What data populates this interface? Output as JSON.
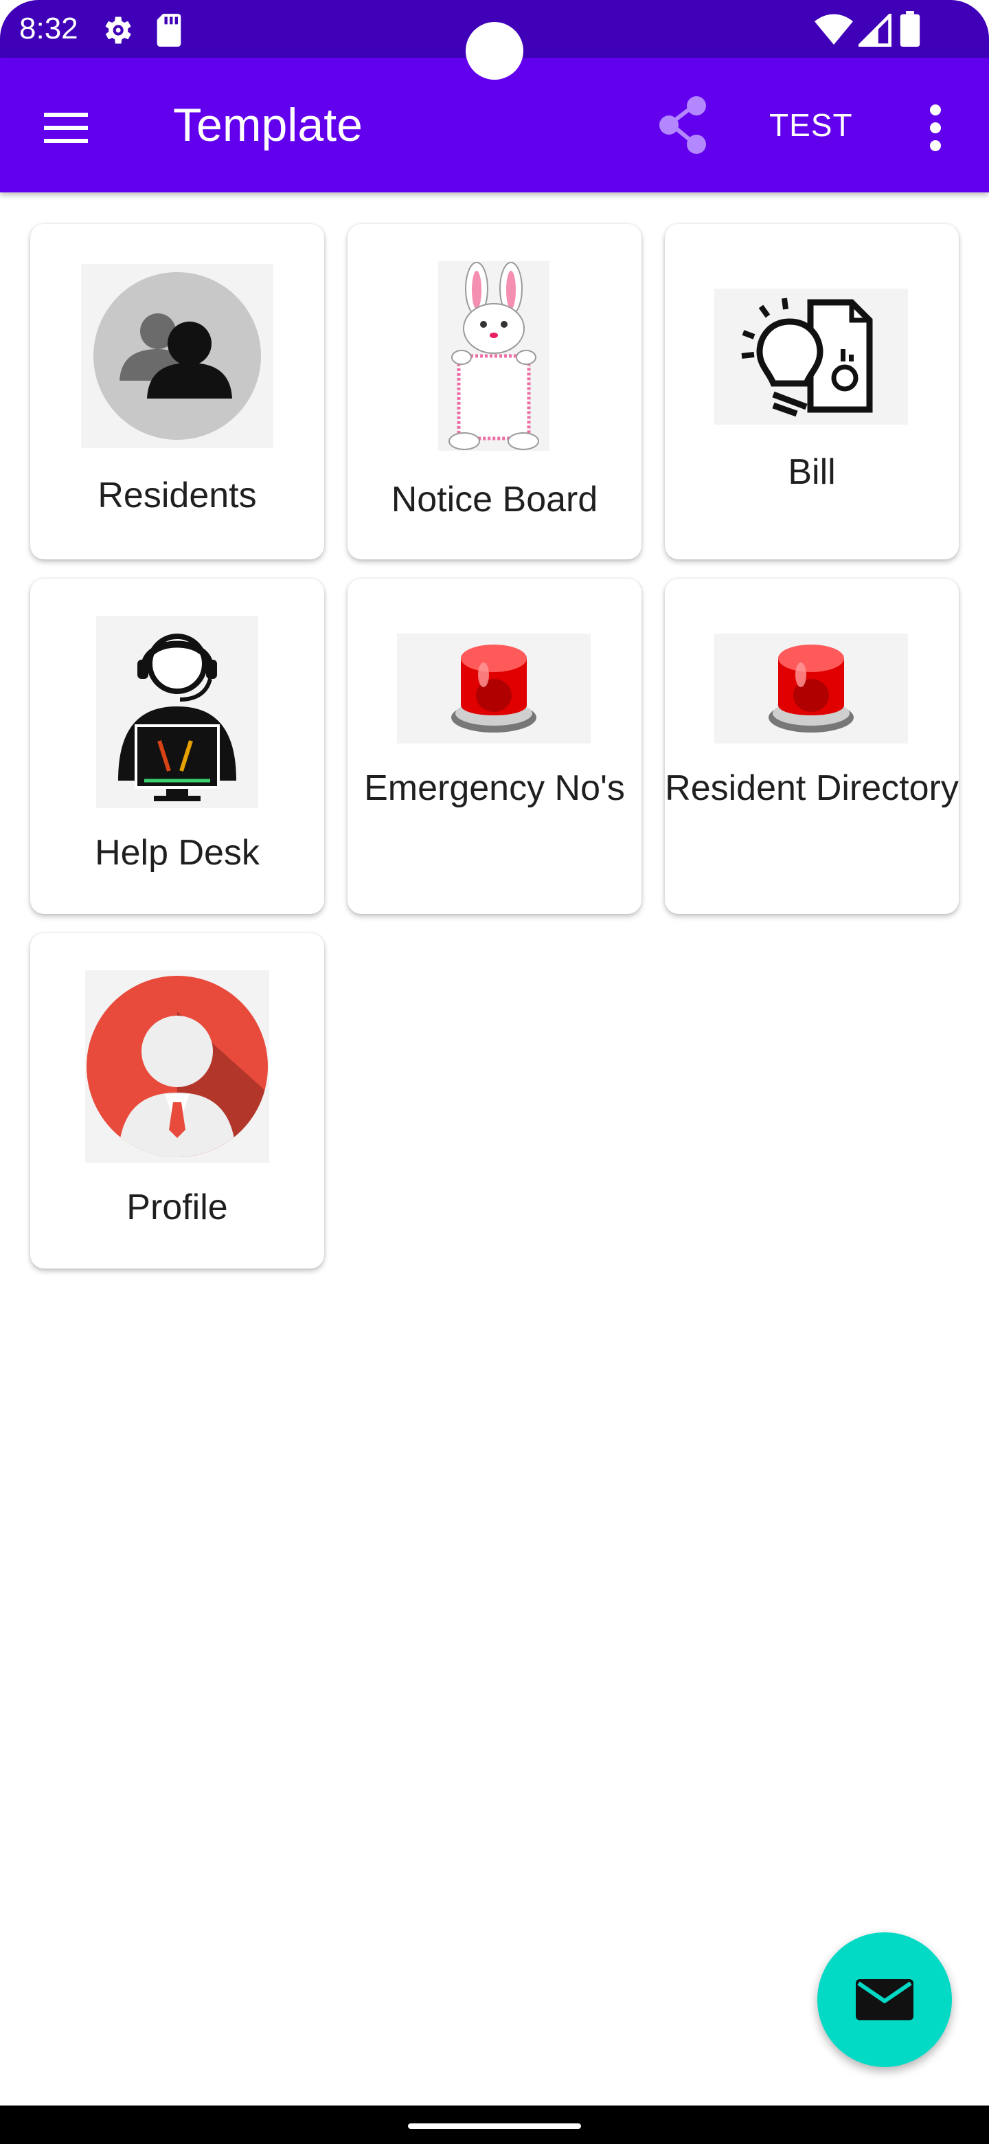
{
  "status_bar": {
    "time": "8:32",
    "icons": [
      "settings-icon",
      "sd-card-icon",
      "wifi-icon",
      "signal-icon",
      "battery-icon"
    ]
  },
  "app_bar": {
    "title": "Template",
    "menu_icon": "hamburger-menu-icon",
    "share_icon": "share-icon",
    "action_label": "TEST",
    "overflow_icon": "more-vertical-icon"
  },
  "tiles": [
    {
      "label": "Residents",
      "icon": "residents-people-icon"
    },
    {
      "label": "Notice Board",
      "icon": "bunny-notice-board-icon"
    },
    {
      "label": "Bill",
      "icon": "bill-bulb-document-icon"
    },
    {
      "label": "Help Desk",
      "icon": "help-desk-support-icon"
    },
    {
      "label": "Emergency No's",
      "icon": "red-siren-icon"
    },
    {
      "label": "Resident Directory",
      "icon": "red-siren-icon"
    },
    {
      "label": "Profile",
      "icon": "profile-avatar-icon"
    }
  ],
  "fab": {
    "icon": "mail-icon"
  },
  "colors": {
    "status_bar": "#3F00B8",
    "app_bar": "#6200EE",
    "fab": "#03DAC5",
    "share_icon": "#B388FF"
  }
}
